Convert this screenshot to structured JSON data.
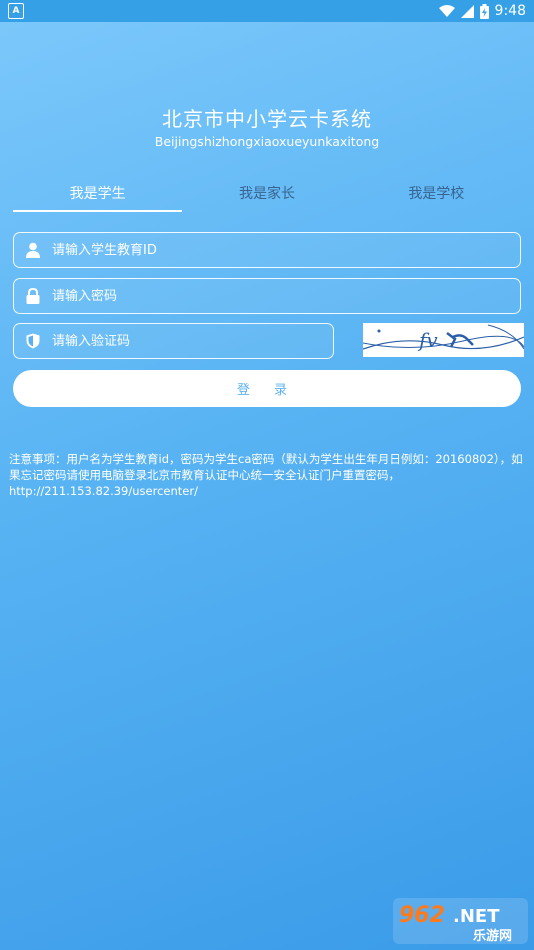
{
  "status_bar": {
    "left_icon": "A",
    "time": "9:48",
    "icons": [
      "wifi-icon",
      "signal-icon",
      "battery-charging-icon"
    ]
  },
  "app": {
    "title": "北京市中小学云卡系统",
    "subtitle": "Beijingshizhongxiaoxueyunkaxitong"
  },
  "tabs": [
    {
      "label": "我是学生",
      "active": true
    },
    {
      "label": "我是家长",
      "active": false
    },
    {
      "label": "我是学校",
      "active": false
    }
  ],
  "form": {
    "student_id": {
      "placeholder": "请输入学生教育ID",
      "value": "",
      "icon": "user-icon"
    },
    "password": {
      "placeholder": "请输入密码",
      "value": "",
      "icon": "lock-icon"
    },
    "captcha": {
      "placeholder": "请输入验证码",
      "value": "",
      "icon": "shield-icon",
      "image_text": "fv么"
    },
    "login_label": "登 录"
  },
  "notice": "注意事项：用户名为学生教育id，密码为学生ca密码（默认为学生出生年月日例如：20160802），如果忘记密码请使用电脑登录北京市教育认证中心统一安全认证门户重置密码，http://211.153.82.39/usercenter/",
  "watermark": {
    "top": "962.NET",
    "bottom": "乐游网"
  },
  "colors": {
    "bg_top": "#7cc8fb",
    "bg_bottom": "#3a9be8",
    "statusbar": "#35a0e6",
    "button_text": "#5db3ee"
  }
}
